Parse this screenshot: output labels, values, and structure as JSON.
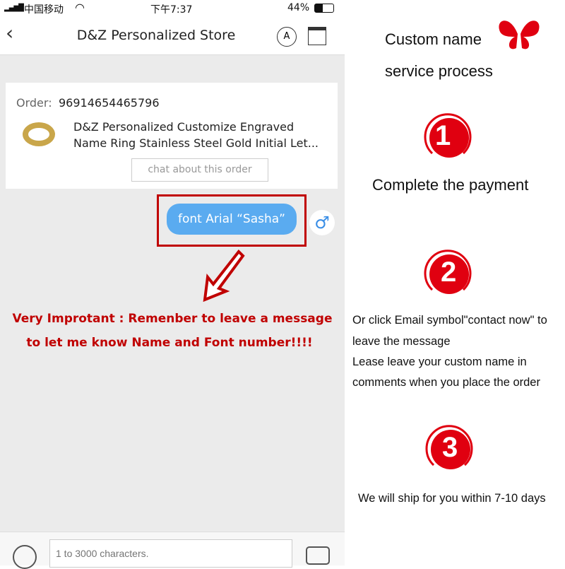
{
  "status": {
    "carrier": "中国移动",
    "time": "下午7:37",
    "battery": "44%",
    "battery_level": 0.44
  },
  "nav": {
    "title": "D&Z Personalized Store"
  },
  "order": {
    "label": "Order:",
    "number": "96914654465796",
    "product": "D&Z Personalized Customize Engraved",
    "product_line2": "Name Ring Stainless Steel Gold Initial Let...",
    "chat_button": "chat about this order"
  },
  "message": {
    "text": "font Arial “Sasha”"
  },
  "warning": {
    "line1": "Very Improtant : Remenber to leave a message",
    "line2": "to let me know Name and Font number!!!!"
  },
  "input": {
    "placeholder": "1 to 3000 characters."
  },
  "process": {
    "title1": "Custom name",
    "title2": "service process",
    "steps": [
      {
        "num": "1",
        "lines": [
          "Complete the payment"
        ]
      },
      {
        "num": "2",
        "lines": [
          "Or click Email symbol\"contact now\" to",
          "leave the message",
          "Lease leave your custom name in",
          "comments when you place the order"
        ]
      },
      {
        "num": "3",
        "lines": [
          "We will ship for you within 7-10 days"
        ]
      }
    ]
  },
  "colors": {
    "accent_red": "#c00000",
    "bubble_blue": "#5aabf0",
    "step_red": "#e00010"
  }
}
